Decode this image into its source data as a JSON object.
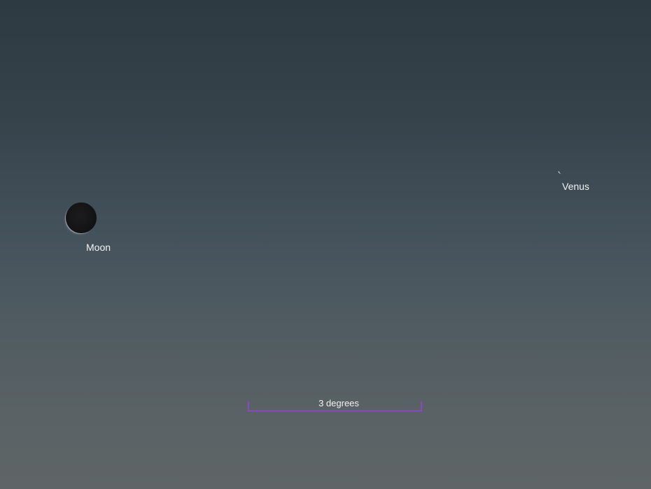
{
  "sky": {
    "objects": [
      {
        "name": "Moon",
        "label": "Moon"
      },
      {
        "name": "Venus",
        "label": "Venus"
      }
    ]
  },
  "scale": {
    "label": "3 degrees",
    "color": "#9b40e0"
  },
  "colors": {
    "label_text": "#f2f2f2",
    "sky_top": "#2e3a42",
    "sky_bottom": "#5f6567"
  }
}
